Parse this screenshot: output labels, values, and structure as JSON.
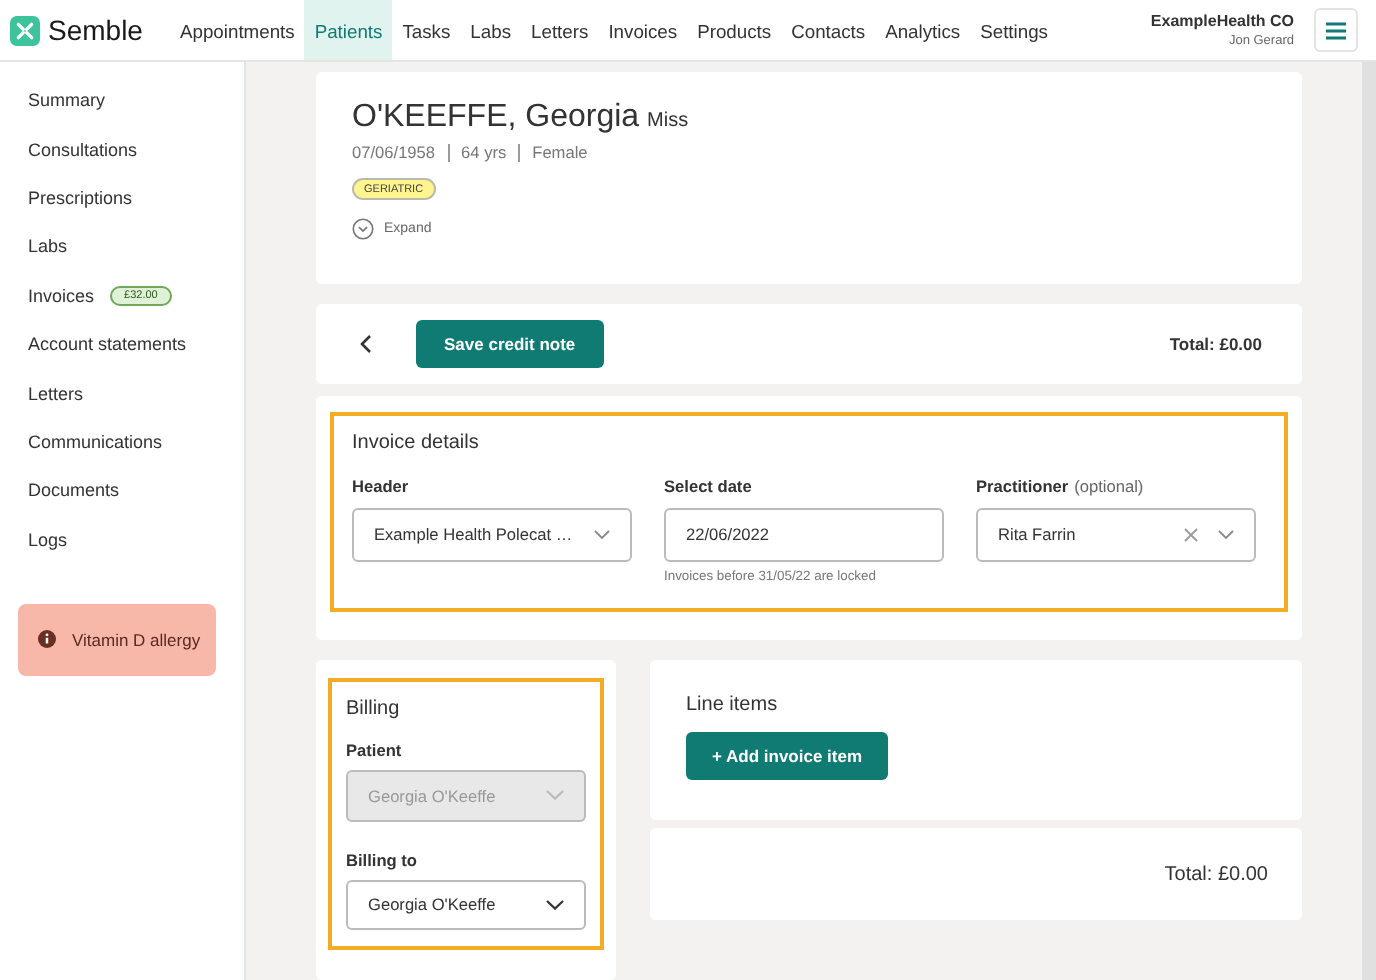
{
  "topbar": {
    "logo_text": "Semble",
    "nav": [
      {
        "label": "Appointments",
        "selected": false
      },
      {
        "label": "Patients",
        "selected": true
      },
      {
        "label": "Tasks",
        "selected": false
      },
      {
        "label": "Labs",
        "selected": false
      },
      {
        "label": "Letters",
        "selected": false
      },
      {
        "label": "Invoices",
        "selected": false
      },
      {
        "label": "Products",
        "selected": false
      },
      {
        "label": "Contacts",
        "selected": false
      },
      {
        "label": "Analytics",
        "selected": false
      },
      {
        "label": "Settings",
        "selected": false
      }
    ],
    "org": "ExampleHealth CO",
    "user": "Jon Gerard"
  },
  "sidebar": {
    "items": [
      {
        "label": "Summary"
      },
      {
        "label": "Consultations"
      },
      {
        "label": "Prescriptions"
      },
      {
        "label": "Labs"
      },
      {
        "label": "Invoices",
        "badge": "£32.00"
      },
      {
        "label": "Account statements"
      },
      {
        "label": "Letters"
      },
      {
        "label": "Communications"
      },
      {
        "label": "Documents"
      },
      {
        "label": "Logs"
      }
    ],
    "alert": "Vitamin D allergy"
  },
  "patient": {
    "name": "O'KEEFFE, Georgia",
    "title": "Miss",
    "details": [
      "07/06/1958",
      "64 yrs",
      "Female"
    ],
    "tags": [
      "GERIATRIC"
    ],
    "expand_label": "Expand"
  },
  "toolbar": {
    "save_label": "Save credit note",
    "total": "Total: £0.00"
  },
  "invoice_details": {
    "title": "Invoice details",
    "highlighted": true,
    "fields": [
      {
        "label": "Header",
        "value": "Example Health Polecat …",
        "kind": "select"
      },
      {
        "label": "Select date",
        "value": "22/06/2022",
        "kind": "date",
        "hint": "Invoices before 31/05/22 are locked"
      },
      {
        "label": "Practitioner",
        "optional": "(optional)",
        "value": "Rita Farrin",
        "kind": "select",
        "clearable": true
      }
    ]
  },
  "billing": {
    "title": "Billing",
    "highlighted": true,
    "fields": [
      {
        "label": "Patient",
        "value": "Georgia O'Keeffe",
        "disabled": true
      },
      {
        "label": "Billing to",
        "value": "Georgia O'Keeffe",
        "disabled": false
      }
    ]
  },
  "line_items": {
    "title": "Line items",
    "add_label": "+ Add invoice item"
  },
  "footer_total": "Total: £0.00"
}
